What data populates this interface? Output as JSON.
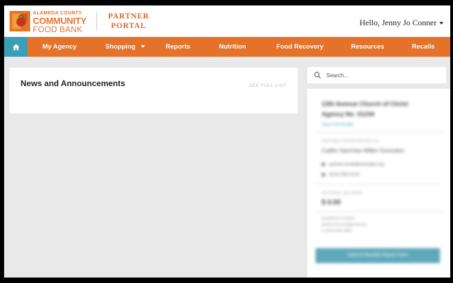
{
  "header": {
    "brand_line1": "ALAMEDA COUNTY",
    "brand_line2": "COMMUNITY",
    "brand_line3": "FOOD BANK",
    "portal_line1": "PARTNER",
    "portal_line2": "PORTAL",
    "greeting": "Hello, Jenny Jo Conner",
    "colors": {
      "brand_orange": "#e8742a",
      "nav_orange": "#e4722b",
      "teal": "#3a9fb6"
    }
  },
  "nav": {
    "home_icon": "home-icon",
    "items": [
      {
        "label": "My Agency"
      },
      {
        "label": "Shopping",
        "dropdown": true
      },
      {
        "label": "Reports"
      },
      {
        "label": "Nutrition"
      },
      {
        "label": "Food Recovery"
      },
      {
        "label": "Resources"
      },
      {
        "label": "Recalls"
      }
    ]
  },
  "news": {
    "title": "News and Announcements",
    "see_full_list": "SEE FULL LIST"
  },
  "search": {
    "placeholder": "Search...",
    "icon": "search-icon"
  },
  "agency": {
    "name": "13th Avenue Church of Christ Agency No. 01234",
    "view_link": "View Full Profile",
    "rep_label": "PARTNER REPRESENTATIVE",
    "rep_name": "Caitlin Sanchez-Miller Gonzalez",
    "email": "partner.email@example.org",
    "phone": "(510) 555-0123",
    "balance_label": "ACCOUNT BALANCE",
    "balance": "$ 0.00",
    "note_label": "Questions? Contact:",
    "note_line1": "partnerservices@accfb.org",
    "note_line2": "or (510) 635-3663",
    "button_label": "Submit Monthly Report Here"
  }
}
